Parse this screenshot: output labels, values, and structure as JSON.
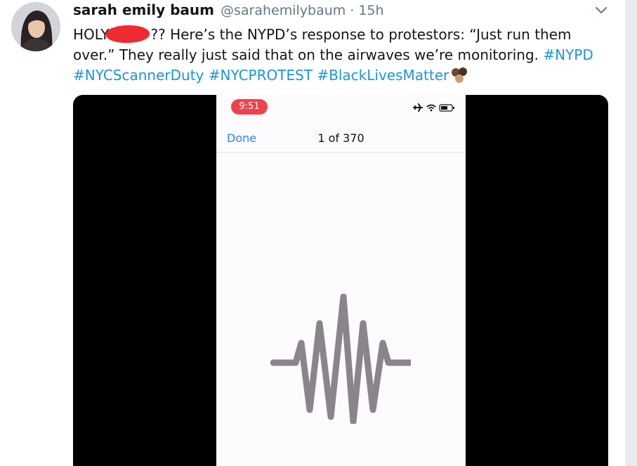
{
  "tweet": {
    "display_name": "sarah emily baum",
    "handle": "@sarahemilybaum",
    "separator": "·",
    "time": "15h",
    "text": {
      "part1": "HOLY",
      "part2": "?? Here’s the NYPD’s response to protestors: “Just run them over.” They really just said that on the airwaves we’re monitoring.",
      "hashtags": [
        "#NYPD",
        "#NYCScannerDuty",
        "#NYCPROTEST",
        "#BlackLivesMatter"
      ]
    },
    "avatar_icon": "profile-photo",
    "menu_icon": "chevron-down-icon",
    "emoji_icon": "raised-fists-emoji"
  },
  "media": {
    "status_time": "9:51",
    "status_icons": [
      "airplane-icon",
      "wifi-icon",
      "battery-icon"
    ],
    "nav": {
      "done_label": "Done",
      "title": "1 of 370"
    },
    "waveform_icon": "audio-waveform-icon"
  },
  "colors": {
    "hashtag": "#1b95e0",
    "done": "#2d7ff9",
    "time_pill": "#f0424c",
    "redaction": "#ee2b33",
    "waveform": "#8a858a"
  }
}
